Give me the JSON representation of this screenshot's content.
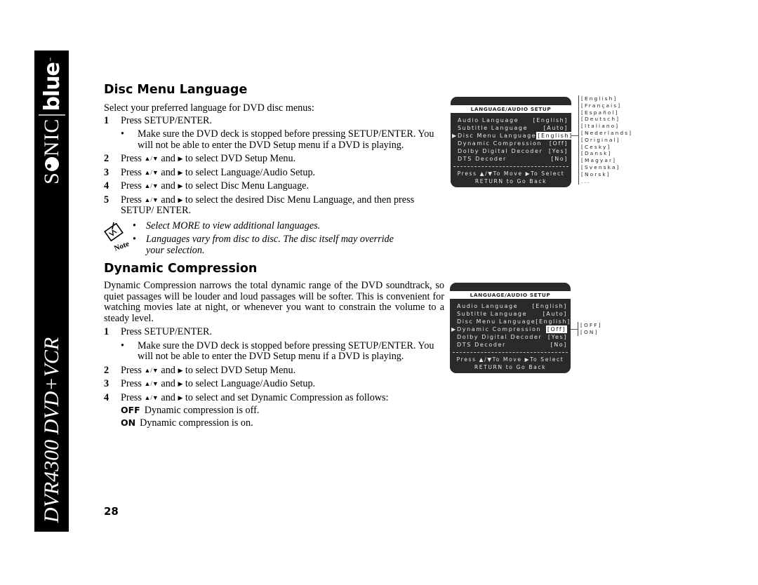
{
  "sidebar": {
    "brand": {
      "part1_pre": "S",
      "part1_post": "NIC",
      "part2": "blue",
      "tm": "™"
    },
    "model": "DVR4300 DVD+VCR"
  },
  "glyphs": {
    "up_down": "▲/▼",
    "right": "▶"
  },
  "section1": {
    "title": "Disc Menu Language",
    "intro": "Select your preferred language for DVD disc menus:",
    "steps": [
      {
        "num": "1",
        "text": "Press SETUP/ENTER."
      },
      {
        "num": "2",
        "pre": "Press",
        "mid": "and",
        "post": "to select DVD Setup Menu."
      },
      {
        "num": "3",
        "pre": "Press",
        "mid": "and",
        "post": "to select Language/Audio Setup."
      },
      {
        "num": "4",
        "pre": "Press",
        "mid": "and",
        "post": "to select Disc Menu Language."
      },
      {
        "num": "5",
        "pre": "Press",
        "mid": "and",
        "post": "to select the desired Disc Menu Language, and then press SETUP/ ENTER."
      }
    ],
    "step1_bullet": "Make sure the DVD deck is stopped before pressing SETUP/ENTER. You will not be able to enter the DVD Setup menu if a DVD is playing.",
    "notes": [
      "Select MORE to view additional languages.",
      "Languages vary from disc to disc. The disc itself may override your selection."
    ],
    "note_label": "Note"
  },
  "section2": {
    "title": "Dynamic Compression",
    "intro": "Dynamic Compression narrows the total dynamic range of the DVD soundtrack, so quiet passages will be louder and loud passages will be softer. This is convenient for watching movies late at night, or whenever you want to constrain the volume to a steady level.",
    "steps": [
      {
        "num": "1",
        "text": "Press SETUP/ENTER."
      },
      {
        "num": "2",
        "pre": "Press",
        "mid": "and",
        "post": "to select DVD Setup Menu."
      },
      {
        "num": "3",
        "pre": "Press",
        "mid": "and",
        "post": "to select Language/Audio Setup."
      },
      {
        "num": "4",
        "pre": "Press",
        "mid": "and",
        "post": "to select and set Dynamic Compression as follows:"
      }
    ],
    "step1_bullet": "Make sure the DVD deck is stopped before pressing SETUP/ENTER. You will not be able to enter the DVD Setup menu if a DVD is playing.",
    "options": [
      {
        "key": "OFF",
        "desc": "Dynamic compression is off."
      },
      {
        "key": "ON",
        "desc": "Dynamic compression is on."
      }
    ]
  },
  "menu": {
    "title": "LANGUAGE/AUDIO SETUP",
    "rows": [
      {
        "label": "Audio Language",
        "value": "[English]"
      },
      {
        "label": "Subtitle Language",
        "value": "[Auto]"
      },
      {
        "label": "Disc Menu Language",
        "value": "[English]"
      },
      {
        "label": "Dynamic Compression",
        "value": "[Off]"
      },
      {
        "label": "Dolby Digital Decoder",
        "value": "[Yes]"
      },
      {
        "label": "DTS Decoder",
        "value": "[No]"
      }
    ],
    "footer1": "Press ▲/▼To Move ▶To Select",
    "footer2": "RETURN to Go Back",
    "pointer": "▶"
  },
  "menu1_selected_row": "Disc Menu Language",
  "menu2_selected_row": "Dynamic Compression",
  "language_options": [
    "[English]",
    "[Français]",
    "[Español]",
    "[Deutsch]",
    "[Italiano]",
    "[Nederlands]",
    "[Original]",
    "[Cesky]",
    "[Dansk]",
    "[Magyar]",
    "[Svenska]",
    "[Norsk]",
    "..."
  ],
  "compression_options": [
    "[OFF]",
    "[ON]"
  ],
  "page_number": "28"
}
